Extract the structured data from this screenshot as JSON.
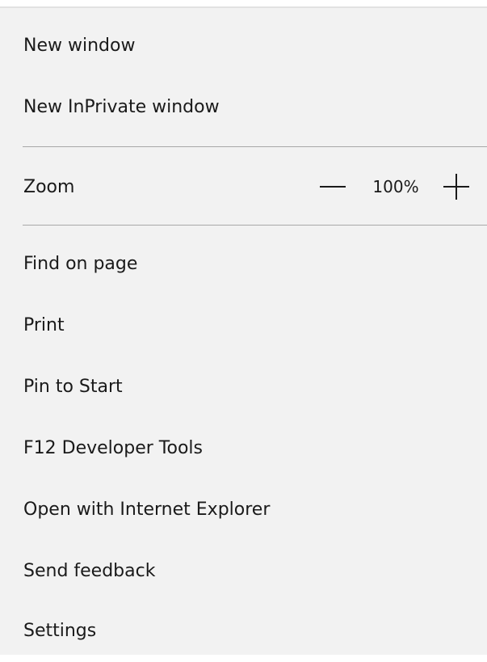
{
  "menu": {
    "top_items": [
      {
        "label": "New window"
      },
      {
        "label": "New InPrivate window"
      }
    ],
    "zoom": {
      "label": "Zoom",
      "value": "100%",
      "minus_icon": "minus-icon",
      "plus_icon": "plus-icon"
    },
    "bottom_items": [
      {
        "label": "Find on page"
      },
      {
        "label": "Print"
      },
      {
        "label": "Pin to Start"
      },
      {
        "label": "F12 Developer Tools"
      },
      {
        "label": "Open with Internet Explorer"
      },
      {
        "label": "Send feedback"
      },
      {
        "label": "Settings"
      }
    ]
  }
}
